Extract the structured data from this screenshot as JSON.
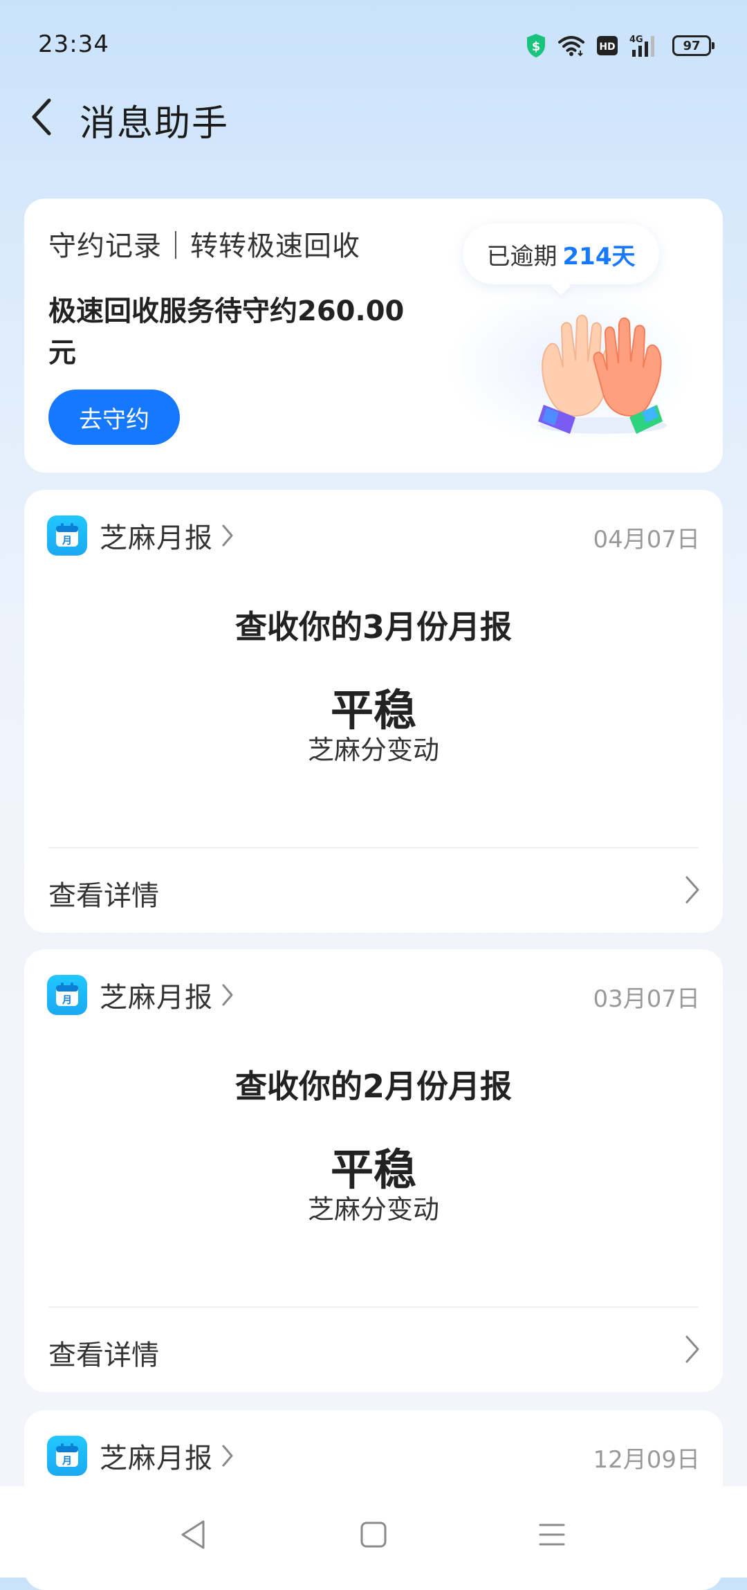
{
  "status_bar": {
    "time": "23:34",
    "battery": "97",
    "network": "4G",
    "hd": "HD",
    "icons": [
      "shield-dollar-icon",
      "wifi-icon",
      "hd-icon",
      "signal-4g-icon",
      "battery-icon"
    ]
  },
  "header": {
    "title": "消息助手",
    "back_icon": "chevron-left-icon"
  },
  "promo": {
    "heading": "守约记录｜转转极速回收",
    "description": "极速回收服务待守约260.00元",
    "button_label": "去守约",
    "overdue_label": "已逾期",
    "overdue_days": "214天",
    "illustration": "high-five-hands"
  },
  "messages": [
    {
      "source": "芝麻月报",
      "date": "04月07日",
      "title": "查收你的3月份月报",
      "status": "平稳",
      "subtitle": "芝麻分变动",
      "action": "查看详情"
    },
    {
      "source": "芝麻月报",
      "date": "03月07日",
      "title": "查收你的2月份月报",
      "status": "平稳",
      "subtitle": "芝麻分变动",
      "action": "查看详情"
    },
    {
      "source": "芝麻月报",
      "date": "12月09日"
    }
  ],
  "app_badge_glyph": "月",
  "colors": {
    "accent": "#1677ff",
    "badge": "#1fb9f7",
    "shield": "#19c37d",
    "background_top": "#c9e2fb"
  },
  "nav": {
    "icons": [
      "triangle-back-icon",
      "square-home-icon",
      "menu-lines-icon"
    ]
  }
}
